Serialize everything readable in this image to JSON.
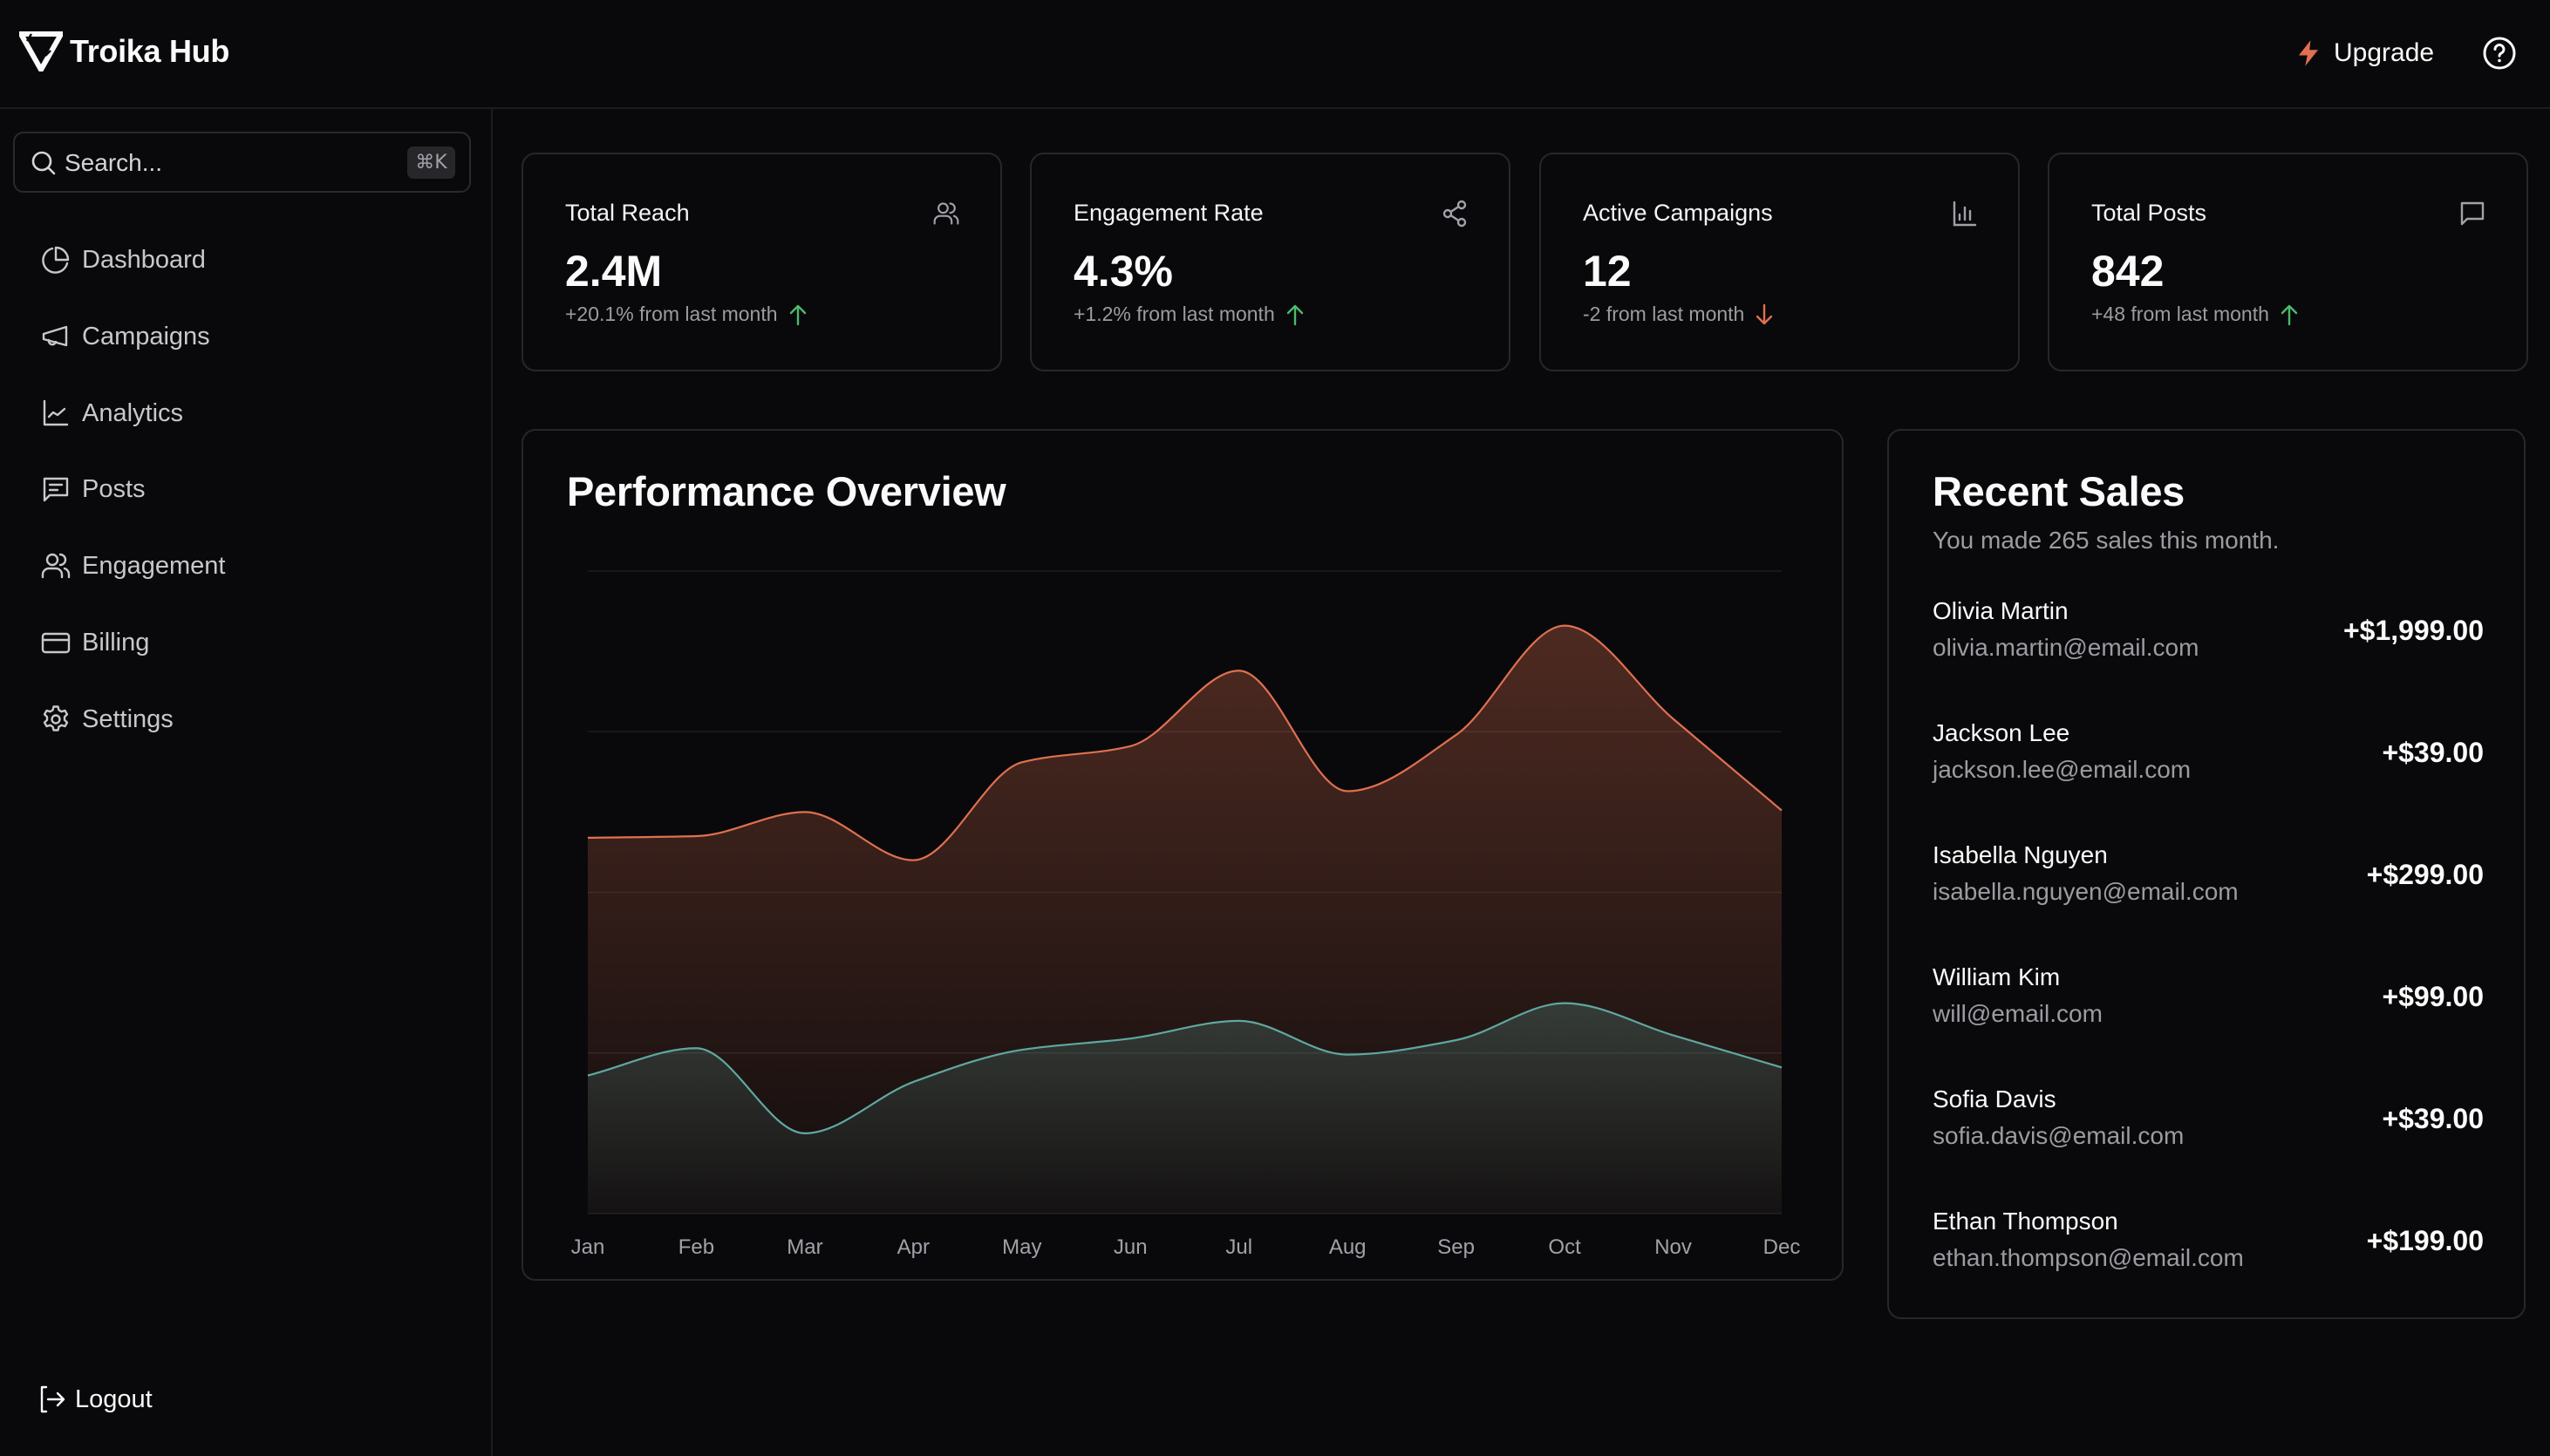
{
  "app": {
    "title": "Troika Hub"
  },
  "header": {
    "upgrade_label": "Upgrade",
    "upgrade_icon": "lightning-bolt-icon",
    "help_icon": "help-circle-icon"
  },
  "colors": {
    "accent": "#e07050",
    "teal": "#5fa8a0",
    "positive": "#4cbb6c",
    "negative": "#e07050",
    "background": "#09090b",
    "border": "#27272a"
  },
  "sidebar": {
    "search": {
      "placeholder": "Search...",
      "shortcut": "⌘K"
    },
    "items": [
      {
        "label": "Dashboard",
        "icon": "pie-chart-icon"
      },
      {
        "label": "Campaigns",
        "icon": "megaphone-icon"
      },
      {
        "label": "Analytics",
        "icon": "line-chart-icon"
      },
      {
        "label": "Posts",
        "icon": "message-square-text-icon"
      },
      {
        "label": "Engagement",
        "icon": "users-icon"
      },
      {
        "label": "Billing",
        "icon": "credit-card-icon"
      },
      {
        "label": "Settings",
        "icon": "gear-icon"
      }
    ],
    "logout_label": "Logout"
  },
  "stats": [
    {
      "title": "Total Reach",
      "value": "2.4M",
      "change": "+20.1% from last month",
      "trend": "up",
      "icon": "users-icon"
    },
    {
      "title": "Engagement Rate",
      "value": "4.3%",
      "change": "+1.2% from last month",
      "trend": "up",
      "icon": "share-icon"
    },
    {
      "title": "Active Campaigns",
      "value": "12",
      "change": "-2 from last month",
      "trend": "down",
      "icon": "bar-chart-icon"
    },
    {
      "title": "Total Posts",
      "value": "842",
      "change": "+48 from last month",
      "trend": "up",
      "icon": "message-square-icon"
    }
  ],
  "performance": {
    "title": "Performance Overview"
  },
  "chart_data": {
    "type": "area",
    "title": "Performance Overview",
    "xlabel": "",
    "ylabel": "",
    "categories": [
      "Jan",
      "Feb",
      "Mar",
      "Apr",
      "May",
      "Jun",
      "Jul",
      "Aug",
      "Sep",
      "Oct",
      "Nov",
      "Dec"
    ],
    "series": [
      {
        "name": "series-1",
        "color": "#e07050",
        "values": [
          234,
          235,
          250,
          220,
          281,
          291,
          338,
          263,
          298,
          366,
          308,
          251
        ]
      },
      {
        "name": "series-2",
        "color": "#5fa8a0",
        "values": [
          86,
          103,
          50,
          82,
          102,
          109,
          120,
          99,
          108,
          131,
          111,
          91
        ]
      }
    ],
    "ylim": [
      0,
      400
    ],
    "y_gridlines": [
      0,
      100,
      200,
      300,
      400
    ],
    "y_tick_labels_visible": false,
    "grid": true,
    "curve": "smooth",
    "legend": "none"
  },
  "sales": {
    "title": "Recent Sales",
    "subtitle": "You made 265 sales this month.",
    "rows": [
      {
        "name": "Olivia Martin",
        "email": "olivia.martin@email.com",
        "amount": "+$1,999.00"
      },
      {
        "name": "Jackson Lee",
        "email": "jackson.lee@email.com",
        "amount": "+$39.00"
      },
      {
        "name": "Isabella Nguyen",
        "email": "isabella.nguyen@email.com",
        "amount": "+$299.00"
      },
      {
        "name": "William Kim",
        "email": "will@email.com",
        "amount": "+$99.00"
      },
      {
        "name": "Sofia Davis",
        "email": "sofia.davis@email.com",
        "amount": "+$39.00"
      },
      {
        "name": "Ethan Thompson",
        "email": "ethan.thompson@email.com",
        "amount": "+$199.00"
      }
    ]
  }
}
